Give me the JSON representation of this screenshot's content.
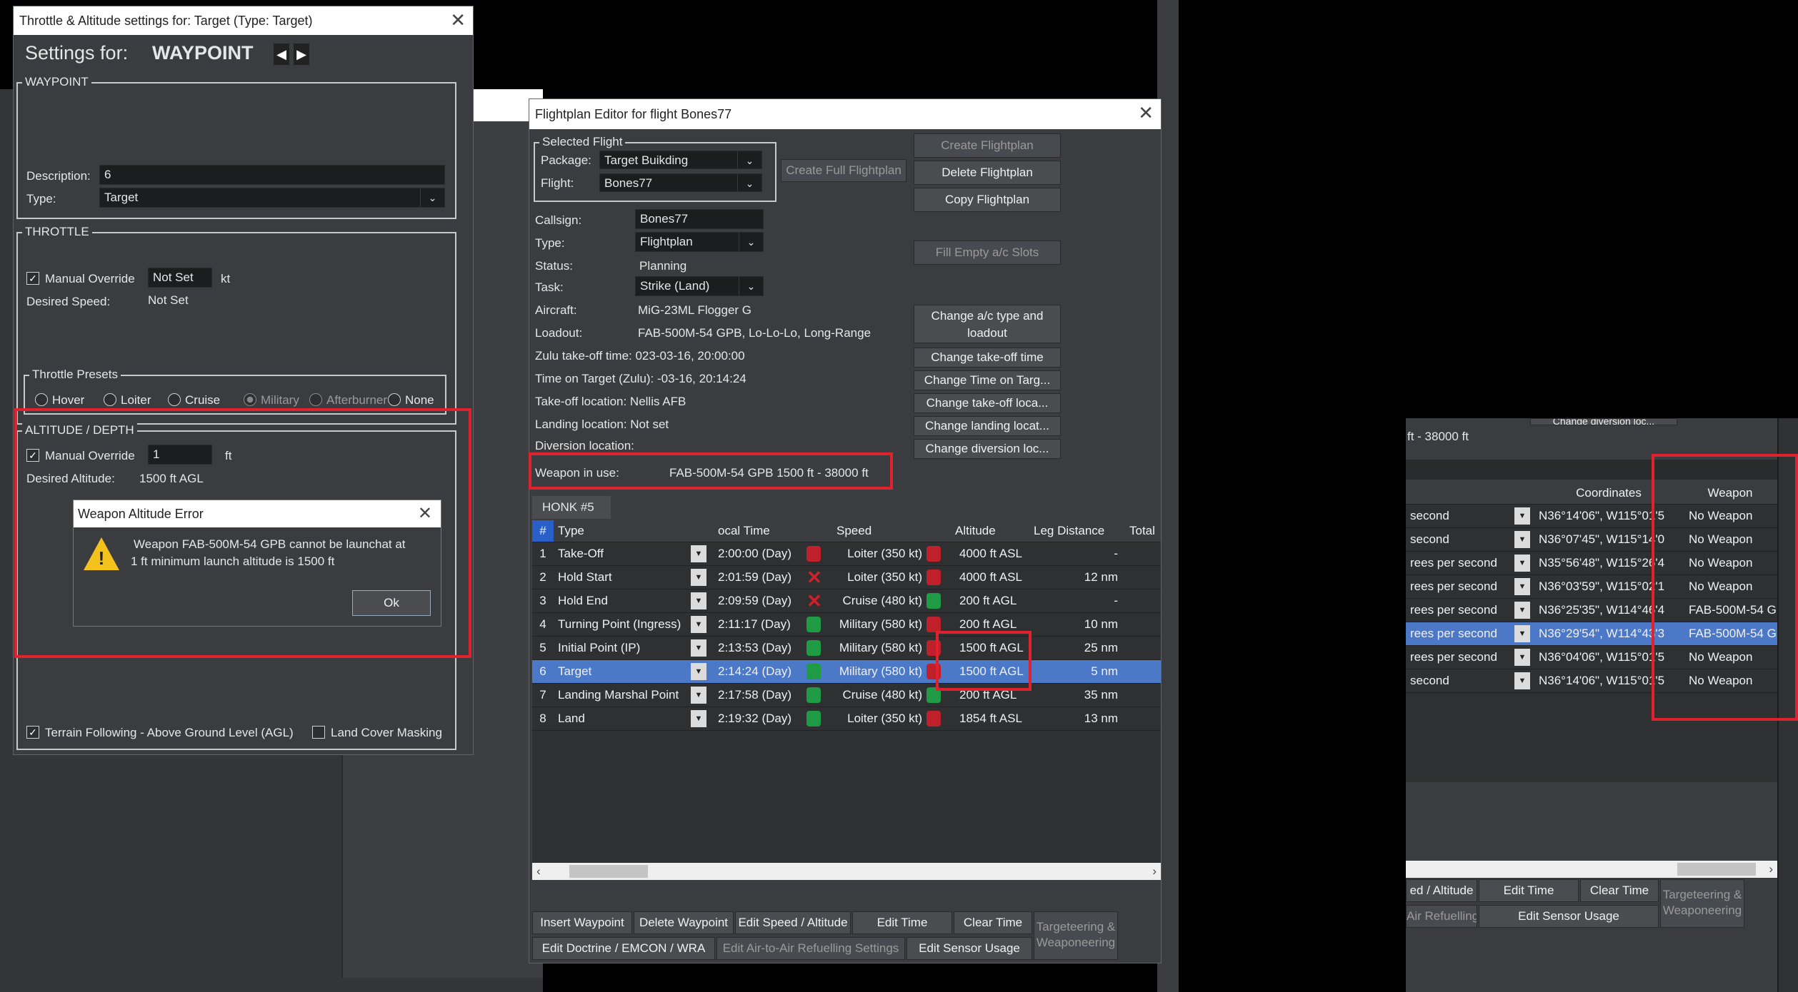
{
  "throttle_window": {
    "title": "Throttle & Altitude settings for: Target (Type: Target)",
    "settings_for_label": "Settings for:",
    "settings_for_value": "WAYPOINT",
    "waypoint_group": "WAYPOINT",
    "description_label": "Description:",
    "description_value": "6",
    "type_label": "Type:",
    "type_value": "Target",
    "throttle_group": "THROTTLE",
    "manual_override_label": "Manual Override",
    "speed_value": "Not Set",
    "speed_unit": "kt",
    "desired_speed_label": "Desired Speed:",
    "desired_speed_value": "Not Set",
    "presets_group": "Throttle Presets",
    "presets": [
      "Hover",
      "Loiter",
      "Cruise",
      "Military",
      "Afterburner",
      "None"
    ],
    "altitude_group": "ALTITUDE / DEPTH",
    "altitude_value": "1",
    "altitude_unit": "ft",
    "desired_altitude_label": "Desired Altitude:",
    "desired_altitude_value": "1500 ft AGL",
    "terrain_following_label": "Terrain Following - Above Ground Level (AGL)",
    "land_cover_label": "Land Cover Masking"
  },
  "error_dialog": {
    "title": "Weapon Altitude Error",
    "message_line1": "Weapon FAB-500M-54 GPB cannot be launchat at",
    "message_line2": "1 ft minimum launch altitude is 1500 ft",
    "ok_label": "Ok"
  },
  "flightplan_window": {
    "title": "Flightplan Editor for flight Bones77",
    "selected_flight_group": "Selected Flight",
    "package_label": "Package:",
    "package_value": "Target Buikding",
    "flight_label": "Flight:",
    "flight_value": "Bones77",
    "create_full_label": "Create Full Flightplan",
    "create_label": "Create Flightplan",
    "delete_label": "Delete Flightplan",
    "copy_label": "Copy Flightplan",
    "fill_empty_label": "Fill Empty a/c Slots",
    "change_type_label_1": "Change a/c type and",
    "change_type_label_2": "loadout",
    "change_takeoff_time_label": "Change take-off time",
    "change_tot_label": "Change Time on Targ...",
    "change_takeoff_loc_label": "Change  take-off loca...",
    "change_landing_loc_label": "Change  landing locat...",
    "change_diversion_label": "Change  diversion loc...",
    "callsign_label": "Callsign:",
    "callsign_value": "Bones77",
    "type_label": "Type:",
    "type_value": "Flightplan",
    "status_label": "Status:",
    "status_value": "Planning",
    "task_label": "Task:",
    "task_value": "Strike (Land)",
    "aircraft_label": "Aircraft:",
    "aircraft_value": "MiG-23ML Flogger G",
    "loadout_label": "Loadout:",
    "loadout_value": "FAB-500M-54 GPB, Lo-Lo-Lo, Long-Range",
    "zulu_takeoff": "Zulu take-off time: 023-03-16, 20:00:00",
    "tot": "Time on Target (Zulu): -03-16, 20:14:24",
    "takeoff_location": "Take-off location: Nellis AFB",
    "landing_location": "Landing location: Not set",
    "diversion_location": "Diversion location:",
    "weapon_label": "Weapon in use:",
    "weapon_value": "FAB-500M-54 GPB 1500 ft - 38000 ft",
    "tab_label": "HONK #5",
    "columns": [
      "#",
      "Type",
      "ocal Time",
      "Speed",
      "Altitude",
      "Leg Distance",
      "Total"
    ],
    "rows": [
      {
        "n": "1",
        "type": "Take-Off",
        "time": "2:00:00 (Day)",
        "time_lock": "red",
        "speed": "Loiter (350 kt)",
        "speed_lock": "red",
        "alt": "4000 ft ASL",
        "leg": "-"
      },
      {
        "n": "2",
        "type": "Hold Start",
        "time": "2:01:59 (Day)",
        "time_lock": "x",
        "speed": "Loiter (350 kt)",
        "speed_lock": "red",
        "alt": "4000 ft ASL",
        "leg": "12 nm"
      },
      {
        "n": "3",
        "type": "Hold End",
        "time": "2:09:59 (Day)",
        "time_lock": "x",
        "speed": "Cruise (480 kt)",
        "speed_lock": "green",
        "alt": "200 ft AGL",
        "leg": "-"
      },
      {
        "n": "4",
        "type": "Turning Point (Ingress)",
        "time": "2:11:17 (Day)",
        "time_lock": "green",
        "speed": "Military (580 kt)",
        "speed_lock": "red",
        "alt": "200 ft AGL",
        "leg": "10 nm"
      },
      {
        "n": "5",
        "type": "Initial Point (IP)",
        "time": "2:13:53 (Day)",
        "time_lock": "green",
        "speed": "Military (580 kt)",
        "speed_lock": "red",
        "alt": "1500 ft AGL",
        "leg": "25 nm"
      },
      {
        "n": "6",
        "type": "Target",
        "time": "2:14:24 (Day)",
        "time_lock": "green",
        "speed": "Military (580 kt)",
        "speed_lock": "red",
        "alt": "1500 ft AGL",
        "leg": "5 nm"
      },
      {
        "n": "7",
        "type": "Landing Marshal Point",
        "time": "2:17:58 (Day)",
        "time_lock": "green",
        "speed": "Cruise (480 kt)",
        "speed_lock": "green",
        "alt": "200 ft AGL",
        "leg": "35 nm"
      },
      {
        "n": "8",
        "type": "Land",
        "time": "2:19:32 (Day)",
        "time_lock": "green",
        "speed": "Loiter (350 kt)",
        "speed_lock": "red",
        "alt": "1854 ft ASL",
        "leg": "13 nm"
      }
    ],
    "btn_insert": "Insert Waypoint",
    "btn_delete": "Delete Waypoint",
    "btn_edit_speed": "Edit Speed / Altitude",
    "btn_edit_time": "Edit Time",
    "btn_clear_time": "Clear Time",
    "btn_targeteering_1": "Targeteering &",
    "btn_targeteering_2": "Weaponeering",
    "btn_doctrine": "Edit Doctrine / EMCON / WRA",
    "btn_air_refuel": "Edit Air-to-Air Refuelling Settings",
    "btn_sensor": "Edit Sensor Usage"
  },
  "right_panel": {
    "top_text": "ft - 38000 ft",
    "top_button_partial": "Change  diversion loc...",
    "col_coords": "Coordinates",
    "col_weapon": "Weapon",
    "rows": [
      {
        "rate": "second",
        "coords": "N36°14'06\", W115°01'5",
        "weapon": "No Weapon"
      },
      {
        "rate": "second",
        "coords": "N36°07'45\", W115°14'0",
        "weapon": "No Weapon"
      },
      {
        "rate": "rees per second",
        "coords": "N35°56'48\", W115°26'4",
        "weapon": "No Weapon"
      },
      {
        "rate": "rees per second",
        "coords": "N36°03'59\", W115°02'1",
        "weapon": "No Weapon"
      },
      {
        "rate": "rees per second",
        "coords": "N36°25'35\", W114°46'4",
        "weapon": "FAB-500M-54 G..."
      },
      {
        "rate": "rees per second",
        "coords": "N36°29'54\", W114°43'3",
        "weapon": "FAB-500M-54 G..."
      },
      {
        "rate": "rees per second",
        "coords": "N36°04'06\", W115°01'5",
        "weapon": "No Weapon"
      },
      {
        "rate": "second",
        "coords": "N36°14'06\", W115°01'5",
        "weapon": "No Weapon"
      }
    ],
    "btn_speed_alt": "ed / Altitude",
    "btn_edit_time": "Edit Time",
    "btn_clear_time": "Clear Time",
    "btn_targeteering_1": "Targeteering &",
    "btn_targeteering_2": "Weaponeering",
    "btn_air_refuel": "Air Refuelling Settings",
    "btn_sensor": "Edit Sensor Usage"
  },
  "colors": {
    "accent_red": "#e0222e",
    "selection_blue": "#4c78c8",
    "window_bg": "#3a3c3f"
  }
}
